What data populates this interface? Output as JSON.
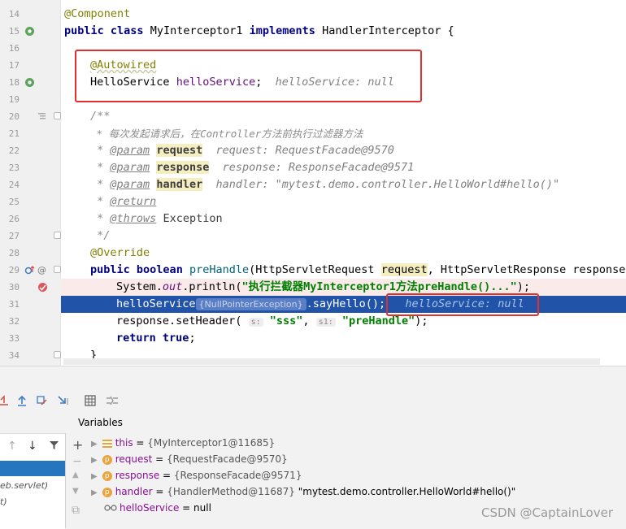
{
  "editor": {
    "lines": [
      {
        "n": "14"
      },
      {
        "n": "15"
      },
      {
        "n": "16"
      },
      {
        "n": "17"
      },
      {
        "n": "18"
      },
      {
        "n": "19"
      },
      {
        "n": "20"
      },
      {
        "n": "21"
      },
      {
        "n": "22"
      },
      {
        "n": "23"
      },
      {
        "n": "24"
      },
      {
        "n": "25"
      },
      {
        "n": "26"
      },
      {
        "n": "27"
      },
      {
        "n": "28"
      },
      {
        "n": "29"
      },
      {
        "n": "30"
      },
      {
        "n": "31"
      },
      {
        "n": "32"
      },
      {
        "n": "33"
      },
      {
        "n": "34"
      }
    ],
    "code": {
      "l14_ann": "@Component",
      "l15_public": "public",
      "l15_class": "class",
      "l15_name": "MyInterceptor1",
      "l15_impl": "implements",
      "l15_iface": "HandlerInterceptor {",
      "l17_ann": "@Autowired",
      "l18_type": "HelloService",
      "l18_field": "helloService",
      "l18_semi": ";",
      "l18_inline": "helloService: null",
      "l20": "/**",
      "l21": " * 每次发起请求后，在Controller方法前执行过滤器方法",
      "l22_tag": "@param",
      "l22_name": "request",
      "l22_inline": "request: RequestFacade@9570",
      "l23_tag": "@param",
      "l23_name": "response",
      "l23_inline": "response: ResponseFacade@9571",
      "l24_tag": "@param",
      "l24_name": "handler",
      "l24_inline": "handler: \"mytest.demo.controller.HelloWorld#hello()\"",
      "l25_tag": "@return",
      "l26_tag": "@throws",
      "l26_name": "Exception",
      "l27": " */",
      "l28_ann": "@Override",
      "l29_public": "public",
      "l29_bool": "boolean",
      "l29_name": "preHandle",
      "l29_p1type": "(HttpServletRequest ",
      "l29_p1": "request",
      "l29_rest": ", HttpServletResponse response,",
      "l30_pre": "System.",
      "l30_out": "out",
      "l30_mid": ".println(",
      "l30_str": "\"执行拦截器MyInterceptor1方法preHandle()...\"",
      "l30_end": ");",
      "l31_var": "helloService",
      "l31_npe": "{NullPointerException}",
      "l31_call": ".sayHello();",
      "l31_inline": "helloService: null",
      "l32_pre": "response.setHeader(",
      "l32_hint1": "s:",
      "l32_str1": "\"sss\"",
      "l32_comma": ",",
      "l32_hint2": "s1:",
      "l32_str2": "\"preHandle\"",
      "l32_end": ");",
      "l33_ret": "return",
      "l33_true": "true",
      "l33_semi": ";",
      "l34": "}"
    }
  },
  "debug": {
    "variables_title": "Variables",
    "frames": {
      "item1": "eb.servlet)",
      "item2": "t)"
    },
    "variables": [
      {
        "name": "this",
        "eq": " = ",
        "value": "{MyInterceptor1@11685}",
        "extra": ""
      },
      {
        "name": "request",
        "eq": " = ",
        "value": "{RequestFacade@9570}",
        "extra": ""
      },
      {
        "name": "response",
        "eq": " = ",
        "value": "{ResponseFacade@9571}",
        "extra": ""
      },
      {
        "name": "handler",
        "eq": " = ",
        "value": "{HandlerMethod@11687}",
        "extra": " \"mytest.demo.controller.HelloWorld#hello()\""
      },
      {
        "name": "helloService",
        "eq": " = ",
        "value": "null",
        "extra": ""
      }
    ],
    "icon_labels": {
      "param": "p"
    }
  },
  "watermark": "CSDN @CaptainLover",
  "colors": {
    "exec_line": "#2154a8",
    "breakpoint_line": "#faeaea",
    "highlight_box": "#e0302c"
  }
}
